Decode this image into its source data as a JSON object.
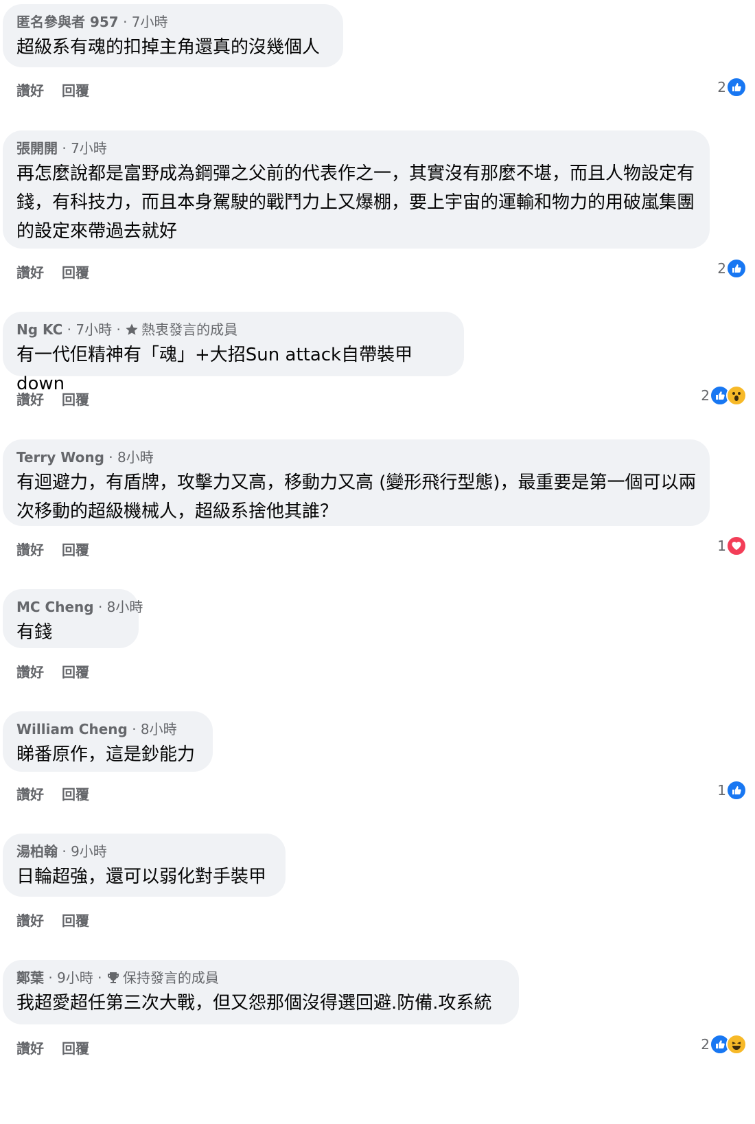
{
  "actions": {
    "like": "讚好",
    "reply": "回覆"
  },
  "comments": [
    {
      "author": "匿名參與者 957",
      "time": "· 7小時",
      "badge": "",
      "text": "超級系有魂的扣掉主角還真的沒幾個人",
      "reaction_count": "2",
      "reactions": [
        "like"
      ]
    },
    {
      "author": "張開開",
      "time": "· 7小時",
      "badge": "",
      "text": "再怎麼說都是富野成為鋼彈之父前的代表作之一，其實沒有那麼不堪，而且人物設定有錢，有科技力，而且本身駕駛的戰鬥力上又爆棚，要上宇宙的運輸和物力的用破嵐集團的設定來帶過去就好",
      "reaction_count": "2",
      "reactions": [
        "like"
      ]
    },
    {
      "author": "Ng KC",
      "time": "· 7小時 ·",
      "badge": "熱衷發言的成員",
      "badge_icon": "star-icon",
      "text": "有一代佢精神有「魂」+大招Sun attack自帶裝甲down",
      "reaction_count": "2",
      "reactions": [
        "like",
        "wow"
      ]
    },
    {
      "author": "Terry Wong",
      "time": "· 8小時",
      "badge": "",
      "text": "有迴避力，有盾牌，攻擊力又高，移動力又高 (變形飛行型態)，最重要是第一個可以兩次移動的超級機械人，超級系捨他其誰？",
      "reaction_count": "1",
      "reactions": [
        "love"
      ]
    },
    {
      "author": "MC Cheng",
      "time": "· 8小時",
      "badge": "",
      "text": "有錢",
      "reaction_count": "",
      "reactions": []
    },
    {
      "author": "William Cheng",
      "time": "· 8小時",
      "badge": "",
      "text": "睇番原作，這是鈔能力",
      "reaction_count": "1",
      "reactions": [
        "like"
      ]
    },
    {
      "author": "湯柏翰",
      "time": "· 9小時",
      "badge": "",
      "text": "日輪超強，還可以弱化對手裝甲",
      "reaction_count": "",
      "reactions": []
    },
    {
      "author": "鄭葉",
      "time": "· 9小時 ·",
      "badge": "保持發言的成員",
      "badge_icon": "trophy-icon",
      "text": "我超愛超任第三次大戰，但又怨那個沒得選回避.防備.攻系統",
      "reaction_count": "2",
      "reactions": [
        "like",
        "haha"
      ]
    }
  ],
  "colors": {
    "like": "#1877f2",
    "love": "#f33e58",
    "wow": "#f7b928",
    "bubble": "#f0f2f5"
  }
}
